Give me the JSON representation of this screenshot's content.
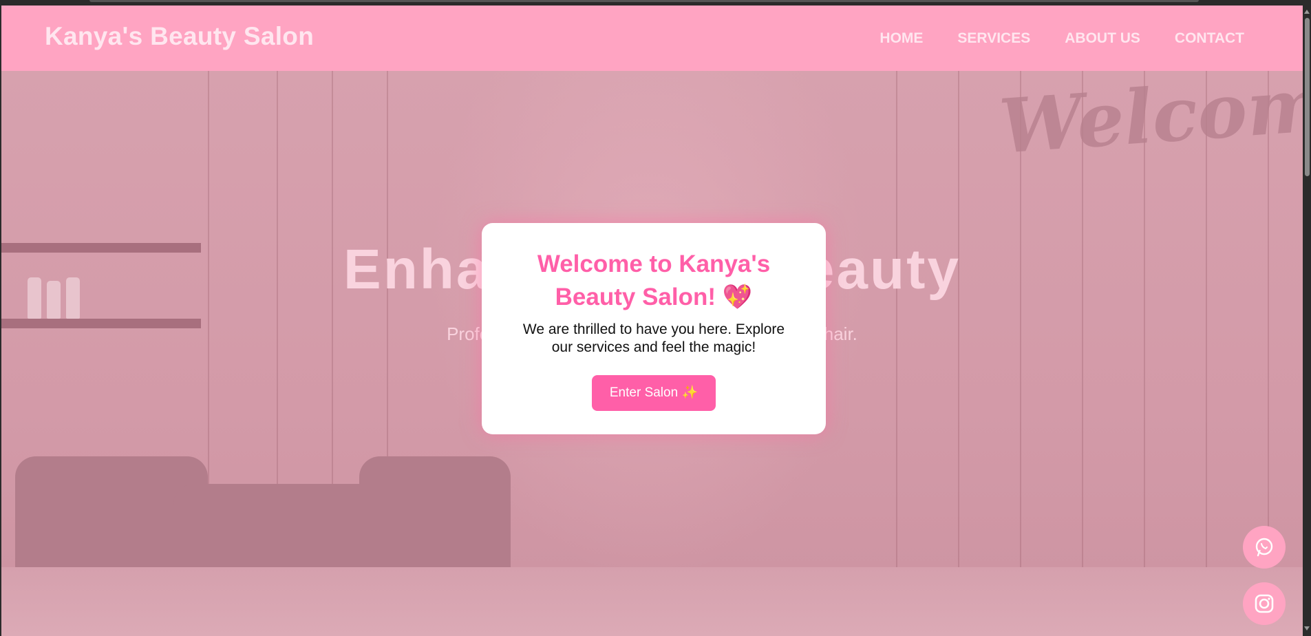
{
  "site": {
    "logo": "Kanya's Beauty Salon",
    "nav": [
      "HOME",
      "SERVICES",
      "ABOUT US",
      "CONTACT"
    ]
  },
  "hero": {
    "title": "Enhance Your Beauty",
    "subtitle": "Professional treatments for your skin, nails and hair.",
    "background_sign": "Welcome"
  },
  "modal": {
    "title": "Welcome to Kanya's Beauty Salon! 💖",
    "text": "We are thrilled to have you here. Explore our services and feel the magic!",
    "button_label": "Enter Salon ✨"
  },
  "floating": {
    "whatsapp_icon": "whatsapp-icon",
    "instagram_icon": "instagram-icon"
  },
  "colors": {
    "header": "#ffa4c2",
    "accent": "#ff5fa8",
    "overlay_tint": "#d9a3b0"
  }
}
